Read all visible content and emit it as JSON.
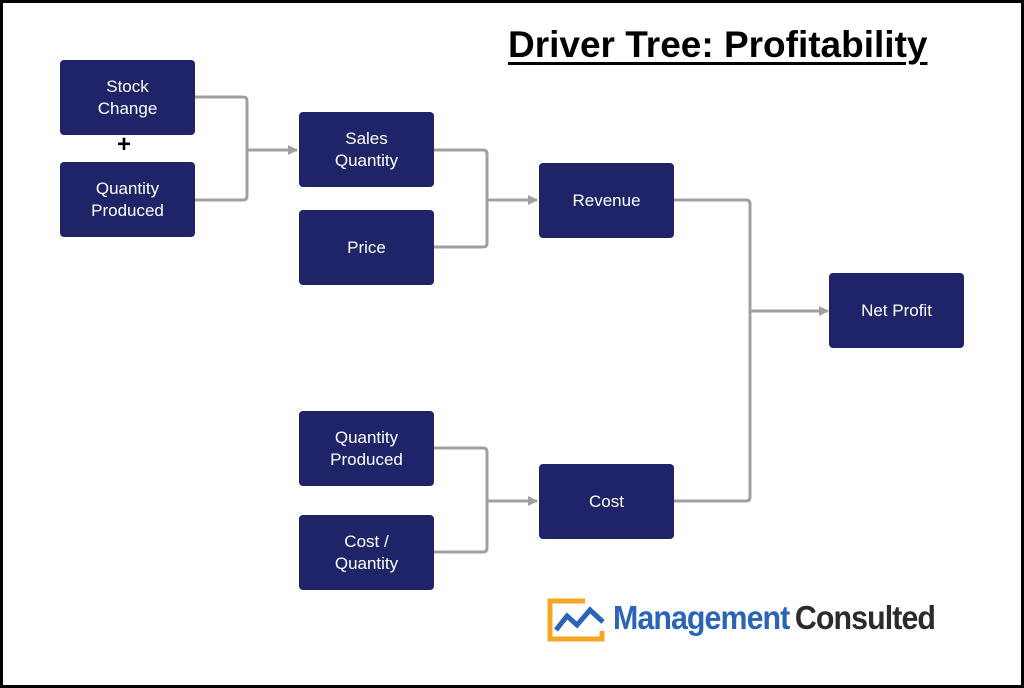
{
  "title": "Driver Tree: Profitability",
  "operator_symbol": "+",
  "nodes": {
    "stock_change": "Stock Change",
    "quantity_produced_top": "Quantity Produced",
    "sales_quantity": "Sales Quantity",
    "price": "Price",
    "revenue": "Revenue",
    "quantity_produced_bottom": "Quantity Produced",
    "cost_per_quantity": "Cost / Quantity",
    "cost": "Cost",
    "net_profit": "Net Profit"
  },
  "edges": [
    {
      "from": "stock_change",
      "to": "sales_quantity"
    },
    {
      "from": "quantity_produced_top",
      "to": "sales_quantity"
    },
    {
      "from": "sales_quantity",
      "to": "revenue"
    },
    {
      "from": "price",
      "to": "revenue"
    },
    {
      "from": "quantity_produced_bottom",
      "to": "cost"
    },
    {
      "from": "cost_per_quantity",
      "to": "cost"
    },
    {
      "from": "revenue",
      "to": "net_profit"
    },
    {
      "from": "cost",
      "to": "net_profit"
    }
  ],
  "logo": {
    "icon": "chart-line-icon",
    "word1": "Management",
    "word2": "Consulted"
  },
  "colors": {
    "node_fill": "#1f2468",
    "node_text": "#ffffff",
    "connector": "#a0a0a0",
    "logo_blue": "#2a63b8",
    "logo_orange": "#f5a623",
    "logo_dark": "#2b2b2b"
  }
}
